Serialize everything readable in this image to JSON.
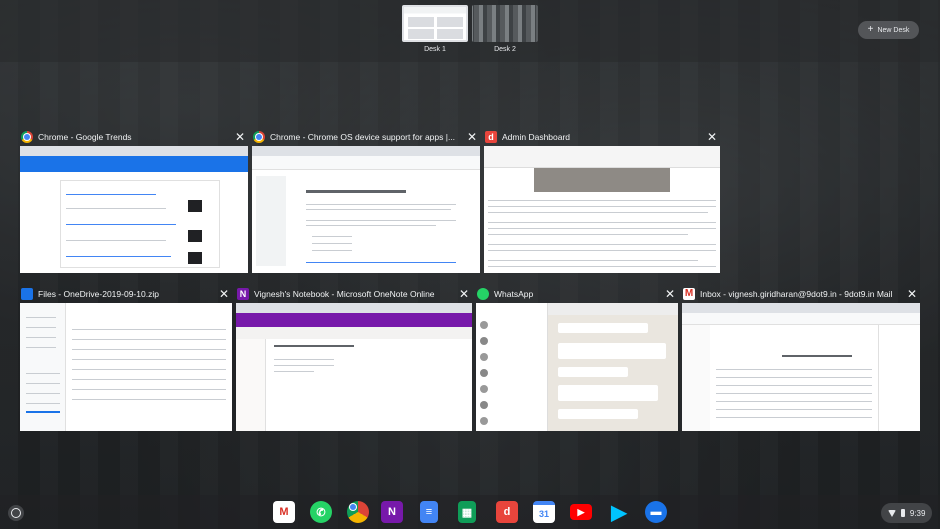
{
  "desks": {
    "items": [
      {
        "label": "Desk 1"
      },
      {
        "label": "Desk 2"
      }
    ],
    "new_desk_label": "New Desk"
  },
  "windows": [
    {
      "title": "Chrome - Google Trends",
      "icon": "chrome-icon"
    },
    {
      "title": "Chrome - Chrome OS device support for apps  |...",
      "icon": "chrome-icon"
    },
    {
      "title": "Admin Dashboard",
      "icon": "d-icon"
    },
    {
      "title": "Files - OneDrive-2019-09-10.zip",
      "icon": "files-icon"
    },
    {
      "title": "Vignesh's Notebook - Microsoft OneNote Online",
      "icon": "onenote-icon"
    },
    {
      "title": "WhatsApp",
      "icon": "whatsapp-icon"
    },
    {
      "title": "Inbox - vignesh.giridharan@9dot9.in - 9dot9.in Mail",
      "icon": "gmail-icon"
    }
  ],
  "shelf": {
    "apps": [
      "gmail-icon",
      "whatsapp-icon",
      "chrome-icon",
      "onenote-icon",
      "docs-icon",
      "sheets-icon",
      "d-icon",
      "calendar-icon",
      "youtube-icon",
      "play-store-icon",
      "files-icon"
    ],
    "calendar_day": "31",
    "onenote_letter": "N",
    "d_letter": "d",
    "time": "9:39"
  },
  "colors": {
    "chrome_blue": "#4285f4",
    "onenote_purple": "#7719aa",
    "whatsapp_green": "#25d366",
    "gmail_red": "#d93025"
  }
}
